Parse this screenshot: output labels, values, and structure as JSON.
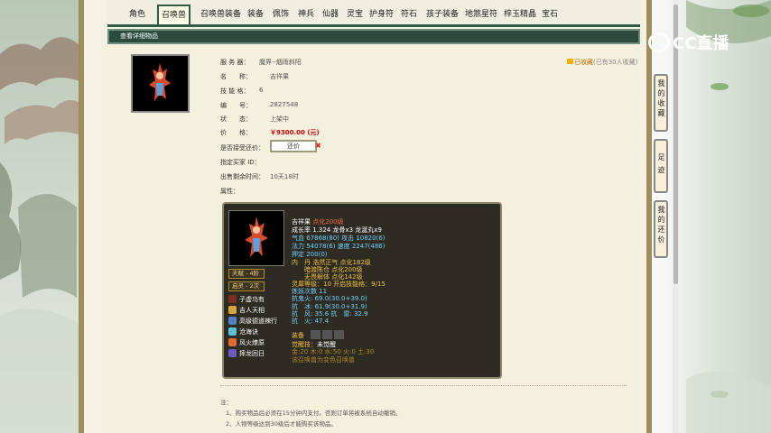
{
  "tabs": [
    "角色",
    "召唤兽",
    "召唤兽装备",
    "装备",
    "佩饰",
    "神兵",
    "仙器",
    "灵宝",
    "护身符",
    "符石",
    "孩子装备",
    "地煞星符",
    "梓玉精晶",
    "宝石"
  ],
  "active_tab": "召唤兽",
  "title_bar": "查看详细物品",
  "favorite": {
    "label": "已收藏",
    "count_text": "(已有30人收藏)"
  },
  "details": {
    "server_label": "服 务 器：",
    "server_value": "魔界·-烟雨斜阳",
    "name_label": "名　　称：",
    "name_value": "吉祥果",
    "skill_label": "技 能 格：",
    "skill_value": "6",
    "id_label": "编　　号：",
    "id_value": "2827548",
    "status_label": "状　　态：",
    "status_value": "上架中",
    "price_label": "价　　格：",
    "price_value": "￥9300.00 (元)",
    "bargain_label": "是否接受还价：",
    "bargain_button": "还价",
    "buyer_label": "指定买家 ID：",
    "remaining_label": "出售剩余时间：",
    "remaining_value": "10天18时",
    "attributes_label": "属性："
  },
  "popup": {
    "line1_name": "吉祥果",
    "line1_level": "点化200级",
    "line2": "成长率 1.324 龙骨x3 龙涎丸x9",
    "line3a": "气血",
    "line3b": "67868(",
    "line3c": "80) 攻击 10820(",
    "line3d": "6)",
    "line4": "法力 54078(6) 速度 2247(486)",
    "line5": "押定 200(0)",
    "line6": "内　丹 浩然正气 点化182级",
    "line7": "　　暗渡陈仓 点化200级",
    "line8": "　　无畏解体 点化142级",
    "line9": "灵犀等级：10 开启技能格：9/15",
    "line10": "炼妖次数 11",
    "line11": "抗鬼火: 69.0(30.0+39.0)",
    "line12": "抗　冰: 61.9(30.0+31.9)",
    "line13": "抗　风: 35.6 抗　雷: 32.9",
    "line14": "抗　火: 47.4",
    "equip_label": "装备",
    "awaken_label": "觉醒技：",
    "awaken_value": "未觉醒",
    "elements": "金:20 木:0 水:50 火:0 土:30",
    "transform": "该召唤兽为变色召唤兽",
    "badge1": "天赋 - 4阶",
    "badge2": "启灵 - 2次",
    "skills": [
      "子虚乌有",
      "吉人天相",
      "高级德道辣行",
      "沧海诀",
      "风火燎原",
      "摔龙回日"
    ]
  },
  "notes": {
    "head": "注：",
    "n1": "1、购买物品后必须在15分钟内支付。否则订单将被系统自动撤销。",
    "n2": "2、人物等级达到30级后才能购买该物品。"
  },
  "side_buttons": [
    "我的收藏",
    "足迹",
    "我的还价"
  ],
  "watermark": "CC直播"
}
